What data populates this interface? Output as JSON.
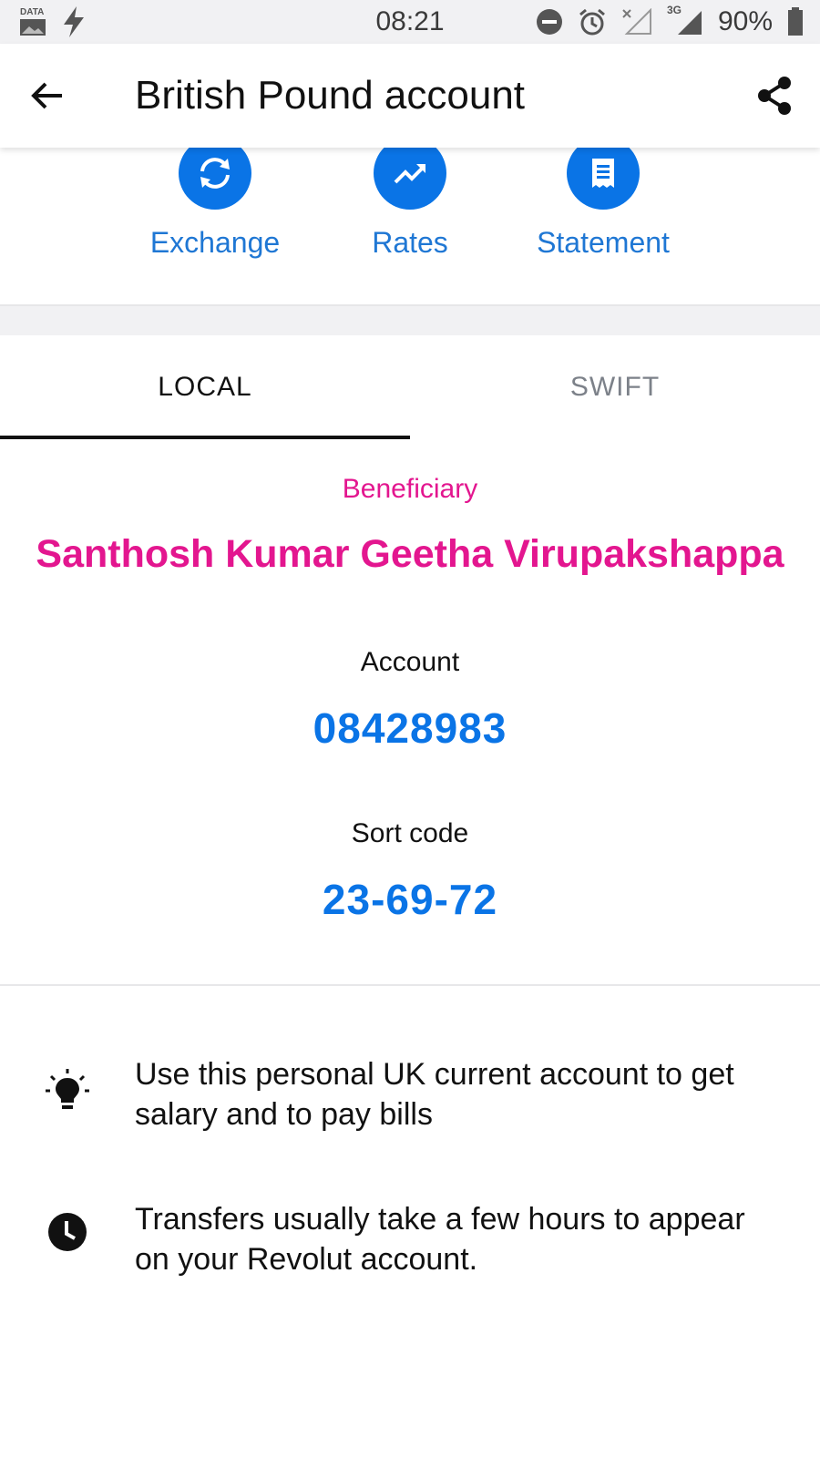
{
  "status_bar": {
    "data_label": "DATA",
    "time": "08:21",
    "network": "3G",
    "battery": "90%"
  },
  "app_bar": {
    "title": "British Pound account"
  },
  "actions": [
    {
      "label": "Exchange",
      "icon": "exchange-icon"
    },
    {
      "label": "Rates",
      "icon": "trending-up-icon"
    },
    {
      "label": "Statement",
      "icon": "statement-icon"
    }
  ],
  "tabs": [
    {
      "label": "LOCAL",
      "active": true
    },
    {
      "label": "SWIFT",
      "active": false
    }
  ],
  "details": {
    "beneficiary_label": "Beneficiary",
    "beneficiary_name": "Santhosh Kumar Geetha Virupakshappa",
    "account_label": "Account",
    "account_number": "08428983",
    "sort_code_label": "Sort code",
    "sort_code": "23-69-72"
  },
  "info": [
    {
      "icon": "lightbulb-icon",
      "text": "Use this personal UK current account to get salary and to pay bills"
    },
    {
      "icon": "clock-icon",
      "text": "Transfers usually take a few hours to appear on your Revolut account."
    }
  ],
  "colors": {
    "accent_blue": "#0a74e6",
    "accent_pink": "#e3168f"
  }
}
